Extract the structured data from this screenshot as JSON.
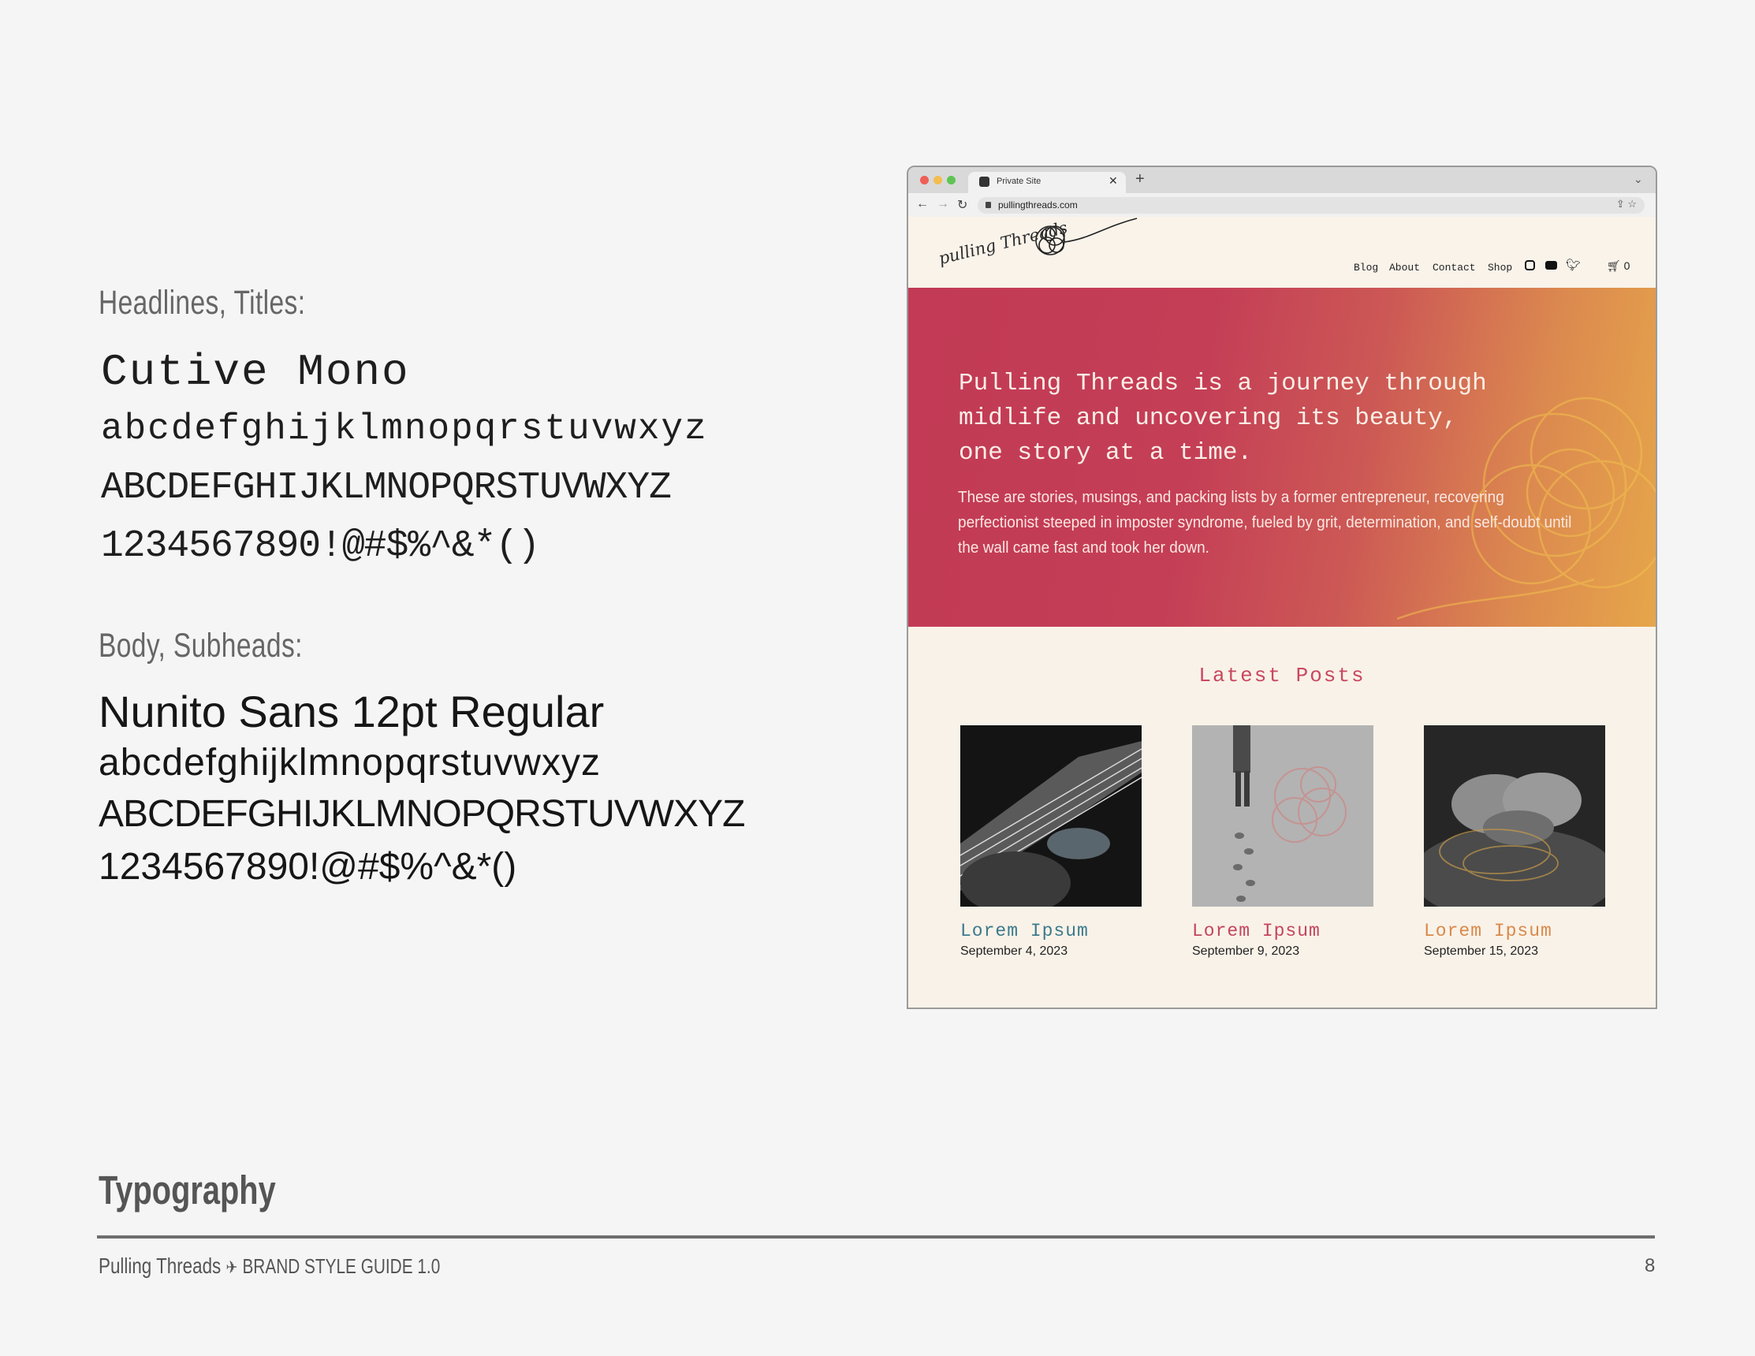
{
  "specimens": {
    "headline_label": "Headlines, Titles:",
    "headline_font": "Cutive Mono",
    "headline_lower": "abcdefghijklmnopqrstuvwxyz",
    "headline_upper": "ABCDEFGHIJKLMNOPQRSTUVWXYZ",
    "headline_digits": "1234567890!@#$%^&*()",
    "body_label": "Body, Subheads:",
    "body_font": "Nunito Sans 12pt Regular",
    "body_lower": "abcdefghijklmnopqrstuvwxyz",
    "body_upper": "ABCDEFGHIJKLMNOPQRSTUVWXYZ",
    "body_digits": "1234567890!@#$%^&*()"
  },
  "browser": {
    "tab_title": "Private Site",
    "url": "pullingthreads.com",
    "logo": "pulling Threads",
    "nav": [
      "Blog",
      "About",
      "Contact",
      "Shop"
    ],
    "cart_count": "0",
    "hero_title": "Pulling Threads is a journey through\nmidlife and uncovering its beauty,\none story at a time.",
    "hero_body": "These are stories, musings, and packing lists by a former entrepreneur, recovering perfectionist steeped in imposter syndrome, fueled by grit, determination, and self-doubt until the wall came fast and took her down.",
    "section_heading": "Latest Posts",
    "posts": [
      {
        "title": "Lorem Ipsum",
        "date": "September 4, 2023",
        "color": "#3c7a8c"
      },
      {
        "title": "Lorem Ipsum",
        "date": "September 9, 2023",
        "color": "#c4455d"
      },
      {
        "title": "Lorem Ipsum",
        "date": "September 15, 2023",
        "color": "#d9894a"
      }
    ]
  },
  "footer": {
    "section_title": "Typography",
    "brand": "Pulling Threads",
    "guide": "BRAND STYLE GUIDE 1.0",
    "page_number": "8"
  }
}
